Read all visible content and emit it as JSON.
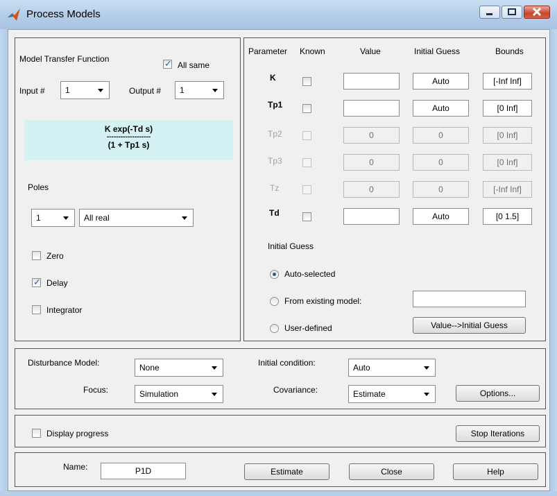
{
  "window": {
    "title": "Process Models"
  },
  "model": {
    "heading": "Model Transfer Function",
    "all_same_label": "All same",
    "all_same_checked": true,
    "input_label": "Input #",
    "input_value": "1",
    "output_label": "Output #",
    "output_value": "1",
    "tf_numerator": "K exp(-Td s)",
    "tf_line": "-------------------",
    "tf_denominator": "(1 + Tp1 s)",
    "poles_label": "Poles",
    "poles_count": "1",
    "poles_type": "All real",
    "zero_label": "Zero",
    "zero_checked": false,
    "delay_label": "Delay",
    "delay_checked": true,
    "integrator_label": "Integrator",
    "integrator_checked": false
  },
  "params": {
    "headers": {
      "parameter": "Parameter",
      "known": "Known",
      "value": "Value",
      "initial_guess": "Initial Guess",
      "bounds": "Bounds"
    },
    "rows": [
      {
        "name": "K",
        "value": "",
        "guess": "Auto",
        "bounds": "[-Inf Inf]",
        "enabled": true
      },
      {
        "name": "Tp1",
        "value": "",
        "guess": "Auto",
        "bounds": "[0 Inf]",
        "enabled": true
      },
      {
        "name": "Tp2",
        "value": "0",
        "guess": "0",
        "bounds": "[0 Inf]",
        "enabled": false
      },
      {
        "name": "Tp3",
        "value": "0",
        "guess": "0",
        "bounds": "[0 Inf]",
        "enabled": false
      },
      {
        "name": "Tz",
        "value": "0",
        "guess": "0",
        "bounds": "[-Inf Inf]",
        "enabled": false
      },
      {
        "name": "Td",
        "value": "",
        "guess": "Auto",
        "bounds": "[0 1.5]",
        "enabled": true
      }
    ]
  },
  "initial_guess": {
    "heading": "Initial Guess",
    "auto_selected": "Auto-selected",
    "from_existing": "From existing model:",
    "from_existing_value": "",
    "user_defined": "User-defined",
    "value_to_guess_button": "Value-->Initial Guess",
    "selected": "auto"
  },
  "estimation": {
    "disturbance_label": "Disturbance Model:",
    "disturbance_value": "None",
    "focus_label": "Focus:",
    "focus_value": "Simulation",
    "initial_condition_label": "Initial condition:",
    "initial_condition_value": "Auto",
    "covariance_label": "Covariance:",
    "covariance_value": "Estimate",
    "options_button": "Options..."
  },
  "progress": {
    "display_progress_label": "Display progress",
    "display_progress_checked": false,
    "stop_button": "Stop Iterations"
  },
  "footer": {
    "name_label": "Name:",
    "name_value": "P1D",
    "estimate_button": "Estimate",
    "close_button": "Close",
    "help_button": "Help"
  }
}
